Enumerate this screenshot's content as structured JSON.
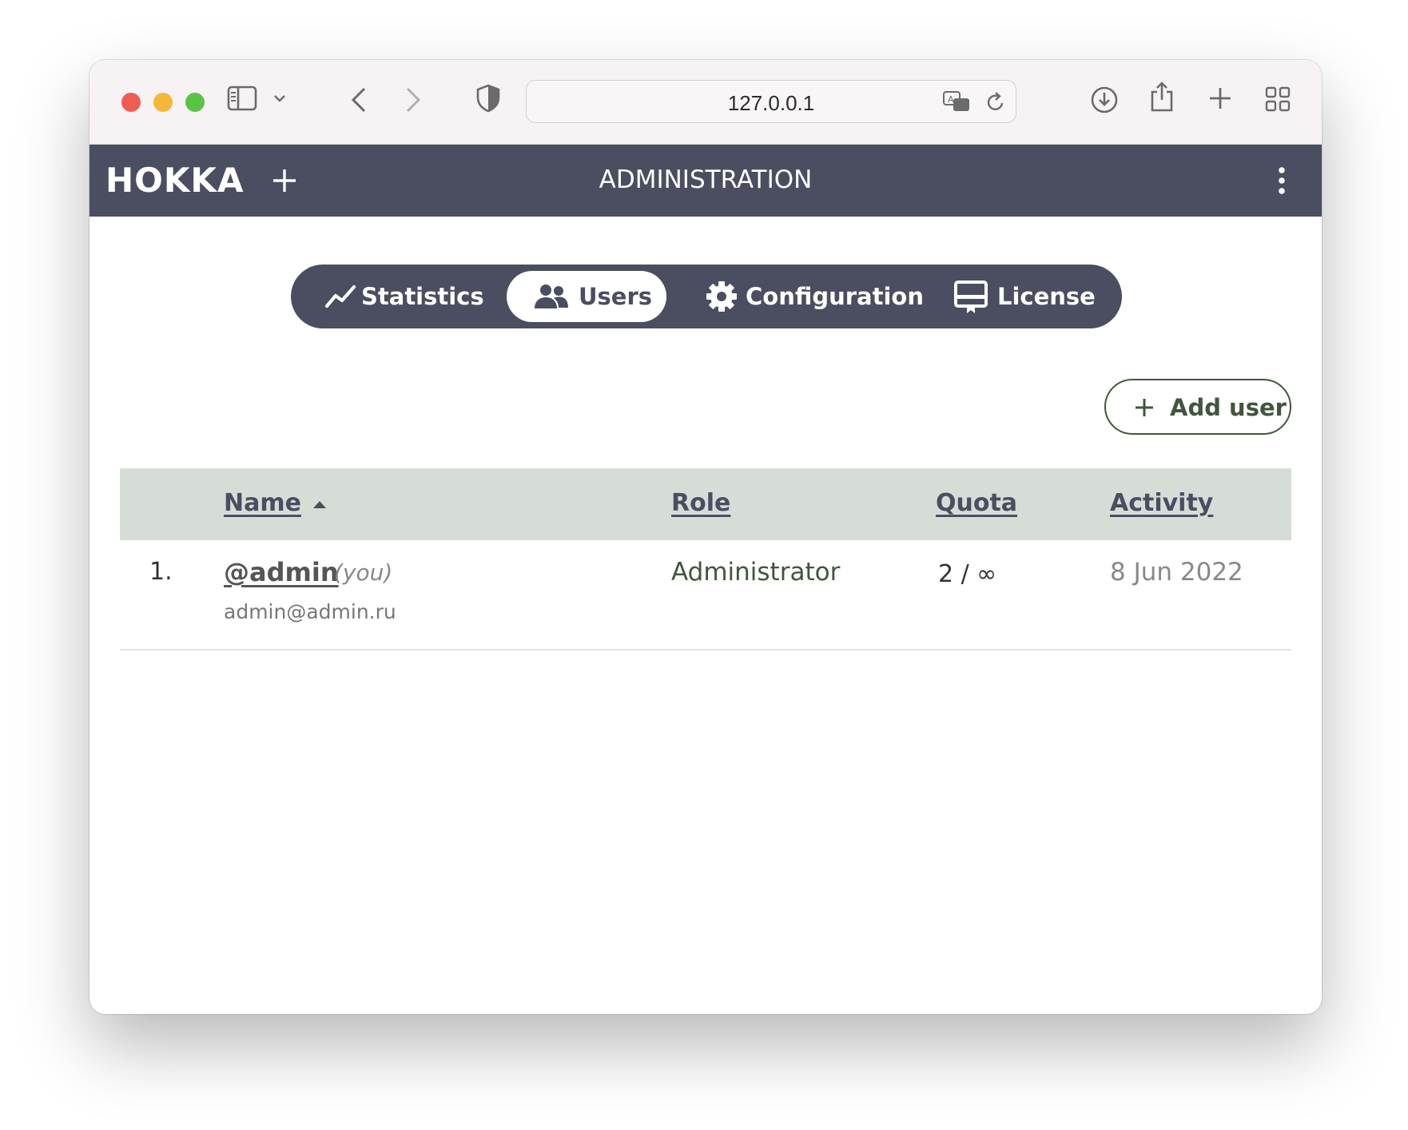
{
  "browser": {
    "url": "127.0.0.1",
    "icons": [
      "sidebar-icon",
      "chevron-down-icon",
      "back-icon",
      "forward-icon",
      "shield-icon",
      "translate-icon",
      "reload-icon",
      "download-icon",
      "share-icon",
      "new-tab-icon",
      "tab-overview-icon"
    ]
  },
  "app": {
    "logo": "HOKKA",
    "title": "ADMINISTRATION",
    "colors": {
      "header": "#4b4d61",
      "accent": "#42553e",
      "table_header": "#d6ddd6"
    }
  },
  "tabs": [
    {
      "label": "Statistics",
      "icon": "chart-line-icon",
      "active": false
    },
    {
      "label": "Users",
      "icon": "users-icon",
      "active": true
    },
    {
      "label": "Configuration",
      "icon": "gear-icon",
      "active": false
    },
    {
      "label": "License",
      "icon": "license-icon",
      "active": false
    }
  ],
  "actions": {
    "add_user": "Add user"
  },
  "table": {
    "columns": {
      "name": "Name",
      "role": "Role",
      "quota": "Quota",
      "activity": "Activity"
    },
    "sort": {
      "column": "Name",
      "direction": "ascending"
    },
    "rows": [
      {
        "index": "1.",
        "username": "@admin",
        "you": "(you)",
        "email": "admin@admin.ru",
        "role": "Administrator",
        "quota": "2 / ∞",
        "activity": "8 Jun 2022"
      }
    ]
  }
}
